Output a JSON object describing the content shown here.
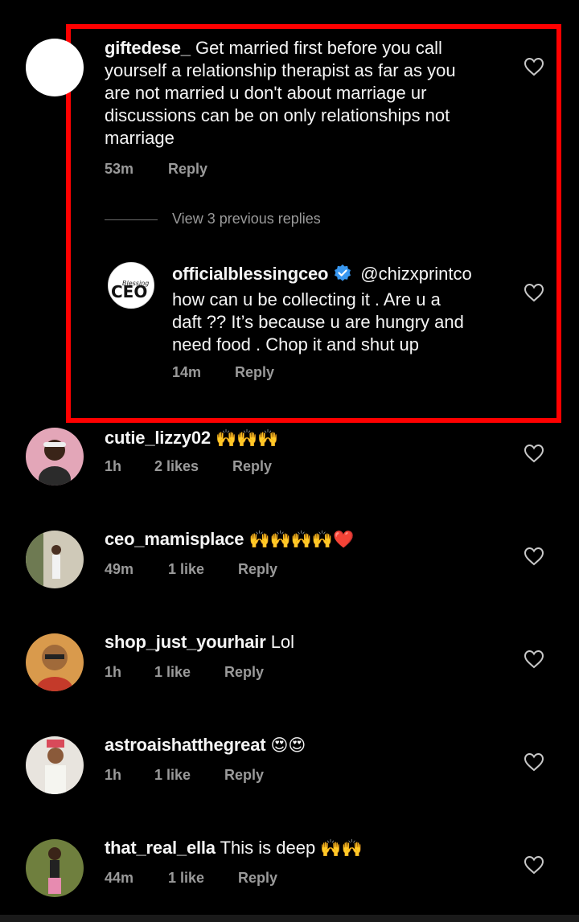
{
  "thread": {
    "main_comment": {
      "username": "giftedese_",
      "lines": [
        "Get married first before you call",
        "yourself a relationship therapist as far as you",
        "are not married u don't about marriage ur",
        "discussions can be on only relationships not",
        "marriage"
      ],
      "time": "53m",
      "reply_label": "Reply"
    },
    "view_replies_label": "View 3 previous replies",
    "reply": {
      "username": "officialblessingceo",
      "mention": "@chizxprintco",
      "avatar_text_top": "Blessing",
      "avatar_text_main": "CEO",
      "lines": [
        "how can u be collecting it . Are u a",
        "daft ?? It’s because u are hungry and",
        "need food . Chop it and shut up"
      ],
      "time": "14m",
      "reply_label": "Reply"
    }
  },
  "comments": [
    {
      "username": "cutie_lizzy02",
      "text": "",
      "emoji": "🙌🙌🙌",
      "time": "1h",
      "likes": "2 likes",
      "reply_label": "Reply"
    },
    {
      "username": "ceo_mamisplace",
      "text": "",
      "emoji": "🙌🙌🙌🙌❤️",
      "time": "49m",
      "likes": "1 like",
      "reply_label": "Reply"
    },
    {
      "username": "shop_just_yourhair",
      "text": "Lol",
      "emoji": "",
      "time": "1h",
      "likes": "1 like",
      "reply_label": "Reply"
    },
    {
      "username": "astroaishatthegreat",
      "text": "",
      "emoji": "😍😍",
      "time": "1h",
      "likes": "1 like",
      "reply_label": "Reply"
    },
    {
      "username": "that_real_ella",
      "text": "This is deep",
      "emoji": "🙌🙌",
      "time": "44m",
      "likes": "1 like",
      "reply_label": "Reply"
    }
  ],
  "colors": {
    "background": "#000000",
    "highlight": "#ff0000",
    "meta_text": "#9a9a9a",
    "verified": "#3897f0"
  }
}
